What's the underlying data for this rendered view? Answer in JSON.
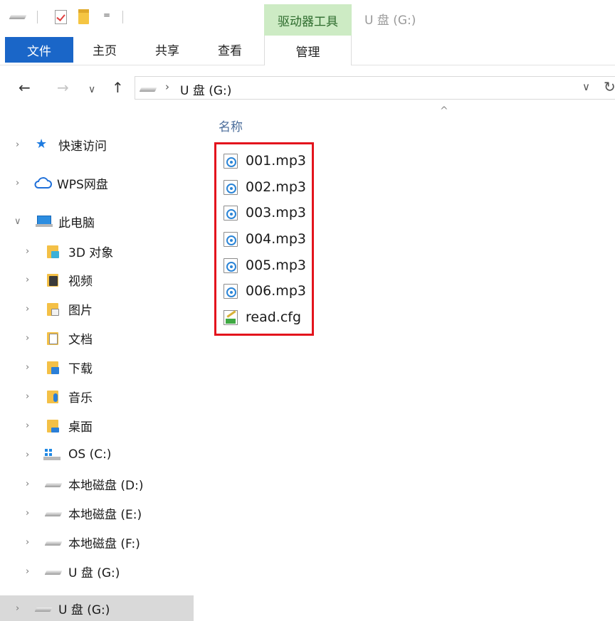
{
  "titlebar": {
    "context_tab": "驱动器工具",
    "window_title": "U 盘 (G:)",
    "quick_access_dropdown": "="
  },
  "ribbon": {
    "tabs": [
      {
        "label": "文件",
        "active": true
      },
      {
        "label": "主页"
      },
      {
        "label": "共享"
      },
      {
        "label": "查看"
      },
      {
        "label": "管理"
      }
    ]
  },
  "address": {
    "back": "←",
    "forward": "→",
    "recent": "∨",
    "up": "↑",
    "chevron": "›",
    "path": "U 盘 (G:)",
    "dropdown": "∨",
    "refresh": "↻"
  },
  "navpane": {
    "items": [
      {
        "label": "快速访问",
        "icon": "quick-access-star-icon",
        "expanded": false
      },
      {
        "label": "WPS网盘",
        "icon": "wps-cloud-icon",
        "expanded": false
      },
      {
        "label": "此电脑",
        "icon": "this-pc-icon",
        "expanded": true
      },
      {
        "label": "3D 对象",
        "icon": "3d-objects-folder-icon"
      },
      {
        "label": "视频",
        "icon": "videos-folder-icon"
      },
      {
        "label": "图片",
        "icon": "pictures-folder-icon"
      },
      {
        "label": "文档",
        "icon": "documents-folder-icon"
      },
      {
        "label": "下载",
        "icon": "downloads-folder-icon"
      },
      {
        "label": "音乐",
        "icon": "music-folder-icon"
      },
      {
        "label": "桌面",
        "icon": "desktop-folder-icon"
      },
      {
        "label": "OS (C:)",
        "icon": "os-drive-icon"
      },
      {
        "label": "本地磁盘 (D:)",
        "icon": "local-disk-icon"
      },
      {
        "label": "本地磁盘 (E:)",
        "icon": "local-disk-icon"
      },
      {
        "label": "本地磁盘 (F:)",
        "icon": "local-disk-icon"
      },
      {
        "label": "U 盘 (G:)",
        "icon": "usb-drive-icon"
      },
      {
        "label": "U 盘 (G:)",
        "icon": "usb-drive-icon",
        "selected": true
      }
    ],
    "arrow_collapsed": "›",
    "arrow_expanded": "∨"
  },
  "content": {
    "column_header": "名称",
    "sort_indicator": "^",
    "files": [
      {
        "name": "001.mp3",
        "icon": "audio-file-icon"
      },
      {
        "name": "002.mp3",
        "icon": "audio-file-icon"
      },
      {
        "name": "003.mp3",
        "icon": "audio-file-icon"
      },
      {
        "name": "004.mp3",
        "icon": "audio-file-icon"
      },
      {
        "name": "005.mp3",
        "icon": "audio-file-icon"
      },
      {
        "name": "006.mp3",
        "icon": "audio-file-icon"
      },
      {
        "name": "read.cfg",
        "icon": "config-file-icon"
      }
    ],
    "highlight_color": "#e3141d"
  }
}
